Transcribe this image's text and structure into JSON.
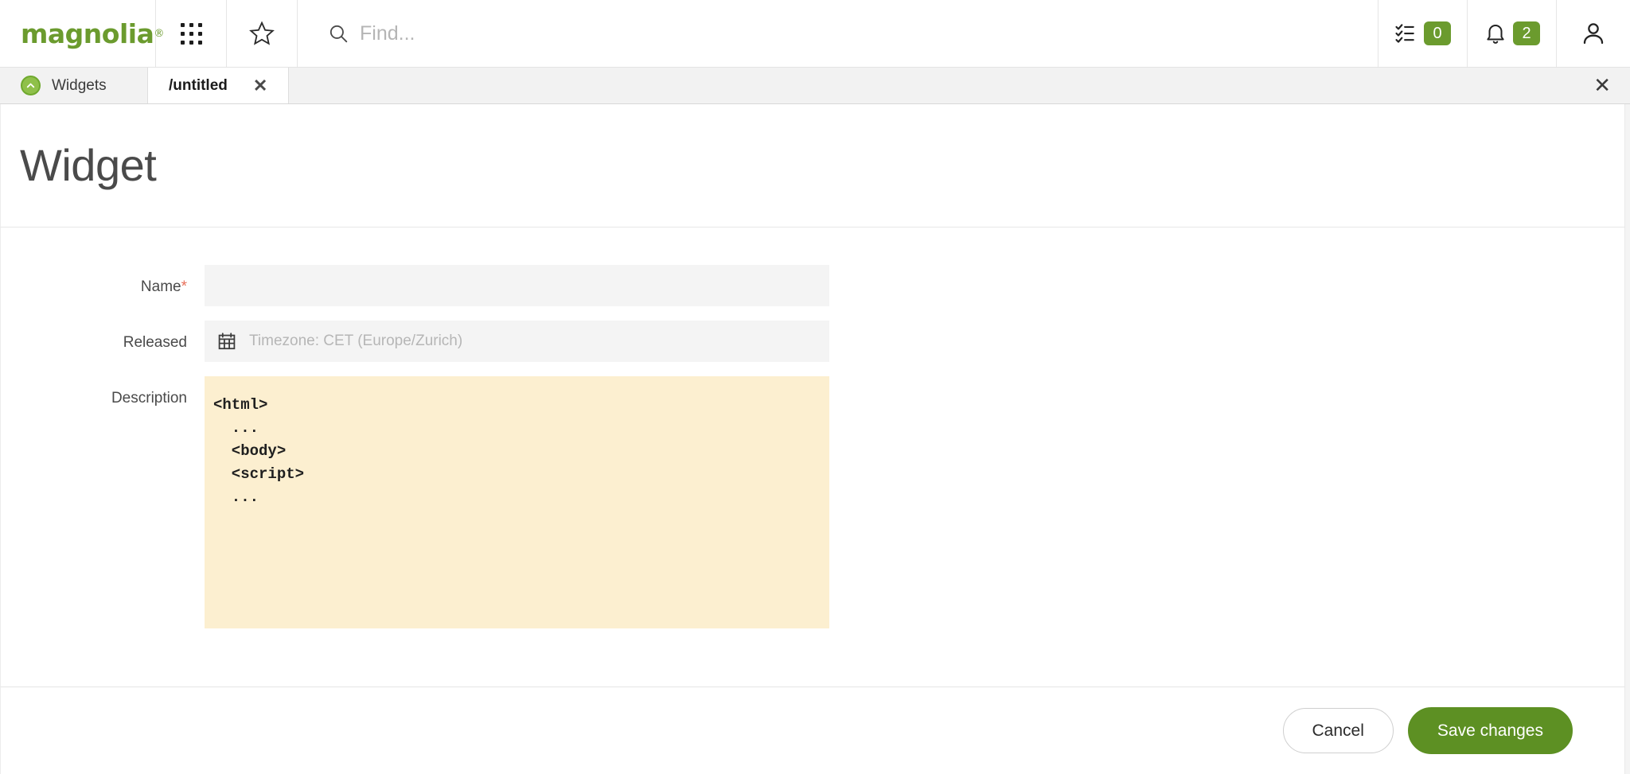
{
  "header": {
    "logo_text": "magnolia",
    "logo_registered": "®",
    "apps_icon": "apps-grid-icon",
    "favorites_icon": "star-icon",
    "search": {
      "placeholder": "Find...",
      "value": "",
      "icon": "search-icon"
    },
    "tasks": {
      "icon": "tasks-checklist-icon",
      "count": "0"
    },
    "notifications": {
      "icon": "bell-icon",
      "count": "2"
    },
    "user": {
      "icon": "user-avatar-icon"
    },
    "badge_color": "#6b9b2e"
  },
  "tabbar": {
    "tabs": [
      {
        "label": "Widgets",
        "icon": "chevron-up-circle-icon",
        "active": false,
        "closable": false
      },
      {
        "label": "/untitled",
        "icon": "",
        "active": true,
        "closable": true
      }
    ],
    "close_all_icon": "close-icon"
  },
  "page": {
    "title": "Widget"
  },
  "form": {
    "fields": [
      {
        "label": "Name",
        "required": true,
        "required_marker": "*",
        "type": "text",
        "value": "",
        "placeholder": ""
      },
      {
        "label": "Released",
        "required": false,
        "required_marker": "",
        "type": "date",
        "value": "",
        "placeholder": "Timezone: CET (Europe/Zurich)",
        "icon": "calendar-icon"
      },
      {
        "label": "Description",
        "required": false,
        "required_marker": "",
        "type": "textarea",
        "value": "<html>\n  ...\n  <body>\n  <script>\n  ...",
        "placeholder": "",
        "background_color": "#fcefd0"
      }
    ]
  },
  "footer": {
    "cancel_label": "Cancel",
    "save_label": "Save changes",
    "save_color": "#5d9023"
  }
}
